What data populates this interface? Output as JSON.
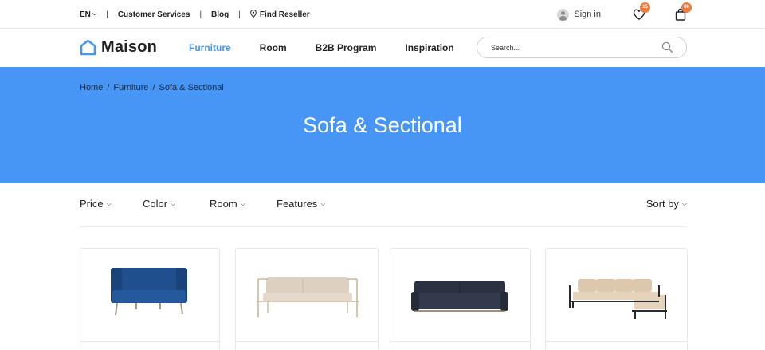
{
  "topbar": {
    "language": "EN",
    "links": [
      "Customer Services",
      "Blog",
      "Find Reseller"
    ],
    "signin": "Sign in",
    "wishlist_count": "15",
    "cart_count": "06"
  },
  "nav": {
    "logo": "Maison",
    "items": [
      "Furniture",
      "Room",
      "B2B Program",
      "Inspiration"
    ],
    "active_index": 0,
    "search_placeholder": "Search..."
  },
  "hero": {
    "breadcrumb": [
      "Home",
      "Furniture",
      "Sofa & Sectional"
    ],
    "title": "Sofa & Sectional"
  },
  "filters": [
    "Price",
    "Color",
    "Room",
    "Features"
  ],
  "sort_label": "Sort by",
  "products": [
    {
      "name": "blue-loveseat"
    },
    {
      "name": "beige-frame-sofa"
    },
    {
      "name": "navy-sofa"
    },
    {
      "name": "sectional-sofa"
    }
  ],
  "colors": {
    "accent": "#4795f5",
    "badge": "#f07a3a"
  }
}
